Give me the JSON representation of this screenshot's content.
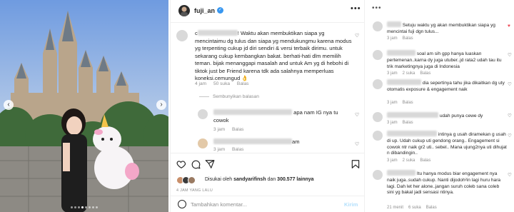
{
  "photo": {
    "nav_prev_icon": "chevron-left-icon",
    "nav_next_icon": "chevron-right-icon",
    "dots_count": 8,
    "active_dot": 4
  },
  "post": {
    "username": "fuji_an",
    "more_icon": "more-horizontal-icon",
    "main_comment": {
      "name_visible": "c",
      "text_start": "! Waktu akan membuktikan siapa yg",
      "text_rest": "mencintaimu dg tulus dan siapa yg mendukungmu karena modus yg terpenting cukup jd diri sendiri & versi terbaik dirimu. untuk sekarang cukup kembangkan bakat. berhati-hati dlm memilih teman. bijak menanggapi masalah and untuk Am yg di hebohi di tiktok just be Friend karena tdk ada salahnya memperluas koneksi.cemungud 👌",
      "time": "4 jam",
      "likes": "50 suka",
      "reply": "Balas"
    },
    "hide_replies": "Sembunyikan balasan",
    "replies": [
      {
        "text_end": "apa nam IG nya tu",
        "text_line2": "cowok",
        "time": "3 jam",
        "reply": "Balas"
      },
      {
        "text_end": "am",
        "time": "3 jam",
        "reply": "Balas"
      }
    ],
    "actions": {
      "like_icon": "heart-icon",
      "comment_icon": "comment-icon",
      "share_icon": "send-icon",
      "save_icon": "bookmark-icon"
    },
    "liked_by": {
      "prefix": "Disukai oleh ",
      "user": "sandyarifinsh",
      "middle": " dan ",
      "count": "300.577",
      "suffix": " lainnya"
    },
    "time_ago": "4 JAM YANG LALU",
    "add_comment": {
      "placeholder": "Tambahkan komentar...",
      "post_label": "Kirim",
      "emoji_icon": "emoji-icon"
    }
  },
  "side": {
    "comments": [
      {
        "text": "Setuju waktu yg akan membuktikan siapa yg mencintai fuji dgn tulus...",
        "time": "3 jam",
        "reply": "Balas",
        "heart": "red"
      },
      {
        "text": "soal am sih gpp hanya luaskan pertemenan..karna dy juga utuber..jd rata2 udah tau itu trik marketingnya juga di Indonesia",
        "time": "3 jam",
        "likes": "2 suka",
        "reply": "Balas"
      },
      {
        "text": "dia sepertinya tahu jika dikaitkan dg uty otomatis exposure & engagement naik",
        "time": "3 jam",
        "reply": "Balas"
      },
      {
        "text": "udah punya cewe dy",
        "time": "3 jam",
        "reply": "Balas"
      },
      {
        "text": "intinya g usah diramekan g usah di up. Udah cukup uti gendong orang.. Engagement si cowok ntr naik gr2 uti.. sebel.. Mana ujung2nya uti dihujat n dibandingin..",
        "time": "3 jam",
        "likes": "2 suka",
        "reply": "Balas"
      },
      {
        "text": "Itu hanya modus biar engagement nya naik juga..sudah cukup. Nanti dijodoh²in lagi huru hara lagi. Dah let her alone..jangan suruh coleb sana coleb sini yg bakal jadi sensasi ntinya.",
        "time": "21 menit",
        "likes": "6 suka",
        "reply": "Balas"
      }
    ]
  }
}
